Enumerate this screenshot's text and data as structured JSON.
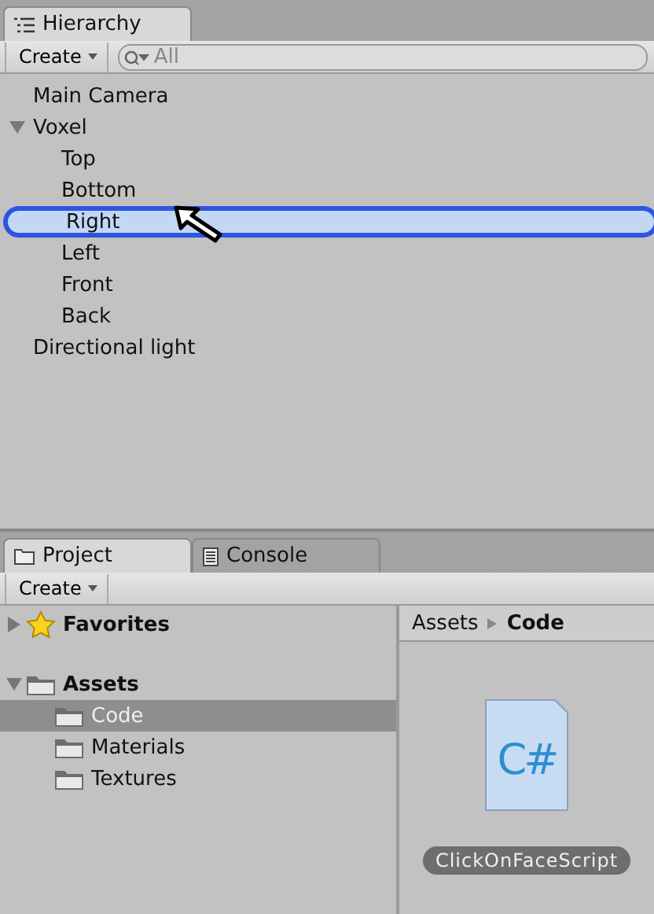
{
  "hierarchy": {
    "tab": {
      "label": "Hierarchy",
      "selected": true
    },
    "create": "Create",
    "search": {
      "placeholder": "All"
    },
    "items": [
      {
        "label": "Main Camera",
        "selected": false
      },
      {
        "label": "Voxel",
        "selected": false,
        "expanded": true,
        "children": [
          {
            "label": "Top",
            "selected": false
          },
          {
            "label": "Bottom",
            "selected": false
          },
          {
            "label": "Right",
            "selected": true
          },
          {
            "label": "Left",
            "selected": false
          },
          {
            "label": "Front",
            "selected": false
          },
          {
            "label": "Back",
            "selected": false
          }
        ]
      },
      {
        "label": "Directional light",
        "selected": false
      }
    ]
  },
  "project": {
    "tabs": [
      {
        "label": "Project",
        "selected": true,
        "kind": "folder"
      },
      {
        "label": "Console",
        "selected": false,
        "kind": "console"
      }
    ],
    "create": "Create",
    "tree": [
      {
        "label": "Favorites",
        "kind": "favorites",
        "expanded": false,
        "selected": false
      },
      {
        "label": "Assets",
        "kind": "folder",
        "expanded": true,
        "selected": false,
        "children": [
          {
            "label": "Code",
            "kind": "folder",
            "selected": true
          },
          {
            "label": "Materials",
            "kind": "folder",
            "selected": false
          },
          {
            "label": "Textures",
            "kind": "folder",
            "selected": false
          }
        ]
      }
    ],
    "breadcrumb": [
      "Assets",
      "Code"
    ],
    "assets": [
      {
        "name": "ClickOnFaceScript",
        "glyph": "C#",
        "selected": true
      }
    ]
  }
}
